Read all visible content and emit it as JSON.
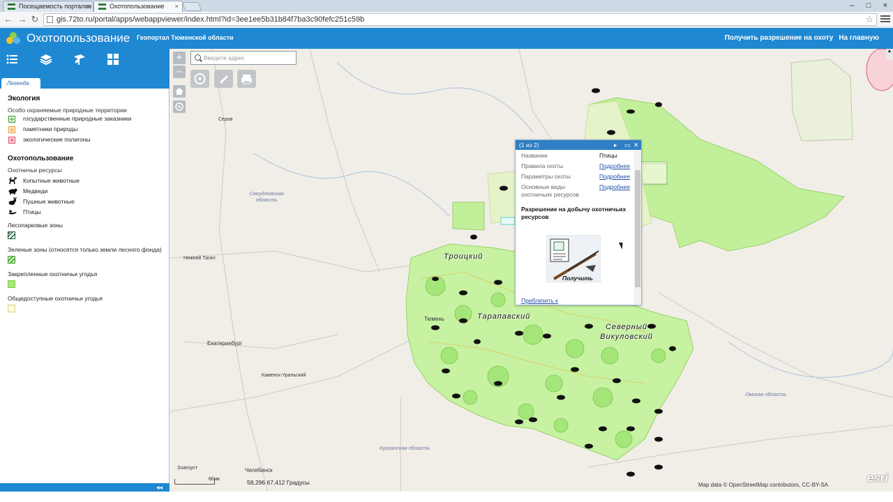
{
  "browser": {
    "tabs": [
      {
        "label": "Посещаемость порталов"
      },
      {
        "label": "Охотопользование"
      }
    ],
    "url": "gis.72to.ru/portal/apps/webappviewer/index.html?id=3ee1ee5b31b84f7ba3c90fefc251c59b",
    "window_buttons": [
      "–",
      "□",
      "×"
    ]
  },
  "header": {
    "title": "Охотопользование",
    "subtitle": "Геопортал Тюменской области",
    "links": [
      "Получить разрешение на охоту",
      "На главную"
    ]
  },
  "panel": {
    "tab": "Легенда",
    "collapse_icon": "◂◂",
    "sections": {
      "ecology": {
        "title": "Экология",
        "subtitle": "Особо охраняемые природные территории",
        "items": [
          "государственные природные заказники",
          "памятники природы",
          "экологические полигоны"
        ]
      },
      "hunting": {
        "title": "Охотопользование",
        "subtitle": "Охотничьи ресурсы",
        "animals": [
          "Копытные животные",
          "Медведи",
          "Пушные животные",
          "Птицы"
        ],
        "zones": [
          "Лесопарковые зоны",
          "Зеленые зоны (относятся только земли лесного фонда)",
          "Закрепленные охотничьи угодья",
          "Общедоступные охотничьи угодья"
        ]
      }
    }
  },
  "map": {
    "search_placeholder": "Введите адрес",
    "zoom_in": "+",
    "zoom_out": "–",
    "scale_label": "60км",
    "coords": "58,296  67,412 Градусы",
    "attribution": "Map data © OpenStreetMap contributors, CC-BY-SA",
    "esri": "esri",
    "cities": [
      "Серов",
      "Нижний Тагил",
      "Екатеринбург",
      "Каменск-Уральский",
      "Златоуст",
      "Челябинск",
      "Тюмень"
    ],
    "oblasts": [
      "Свердловская область",
      "Курганская область",
      "Омская область"
    ],
    "districts": [
      "Троицкий",
      "Тарапавский",
      "Северный Викуловский"
    ]
  },
  "popup": {
    "counter": "(1 из 2)",
    "rows": [
      {
        "key": "Название",
        "value": "Птицы"
      },
      {
        "key": "Правила охоты",
        "value": "Подробнее"
      },
      {
        "key": "Параметры охоты",
        "value": "Подробнее"
      },
      {
        "key": "Основные виды охотничьих ресурсов",
        "value": "Подробнее"
      }
    ],
    "title": "Разрешение на добычу охотничьих ресурсов",
    "image_label": "Получить",
    "zoom_link": "Приблизить к"
  },
  "colors": {
    "header_blue": "#1e88d2",
    "green_fill": "#b7f08a",
    "green_stroke": "#7cc44a",
    "reserve_red": "#e45a6e"
  }
}
